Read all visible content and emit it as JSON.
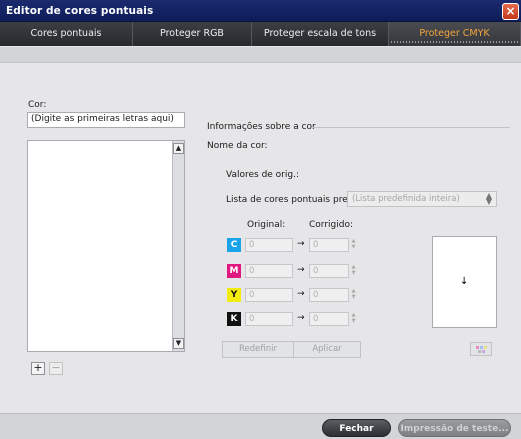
{
  "window": {
    "title": "Editor de cores pontuais"
  },
  "tabs": [
    {
      "label": "Cores pontuais",
      "active": false
    },
    {
      "label": "Proteger RGB",
      "active": false
    },
    {
      "label": "Proteger escala de tons",
      "active": false
    },
    {
      "label": "Proteger CMYK",
      "active": true
    }
  ],
  "left": {
    "color_label": "Cor:",
    "search_placeholder": "(Digite as primeiras letras aqui)",
    "add_label": "+",
    "remove_label": "−"
  },
  "info": {
    "section_title": "Informações sobre a cor",
    "color_name_label": "Nome da cor:",
    "orig_values_label": "Valores de orig.:",
    "predefined_list_label": "Lista de cores pontuais predef.:",
    "predefined_list_value": "(Lista predefinida inteira)",
    "original_header": "Original:",
    "corrected_header": "Corrigido:",
    "channels": [
      {
        "letter": "C",
        "color": "#1aa3e8",
        "original": "0",
        "corrected": "0"
      },
      {
        "letter": "M",
        "color": "#e0187f",
        "original": "0",
        "corrected": "0"
      },
      {
        "letter": "Y",
        "color": "#f2ec10",
        "original": "0",
        "corrected": "0"
      },
      {
        "letter": "K",
        "color": "#111111",
        "original": "0",
        "corrected": "0"
      }
    ],
    "reset_label": "Redefinir",
    "apply_label": "Aplicar"
  },
  "footer": {
    "close_label": "Fechar",
    "test_print_label": "Impressão de teste..."
  },
  "colors": {
    "titlebar": "#1a2a6e",
    "active_tab_text": "#f2a53a"
  }
}
